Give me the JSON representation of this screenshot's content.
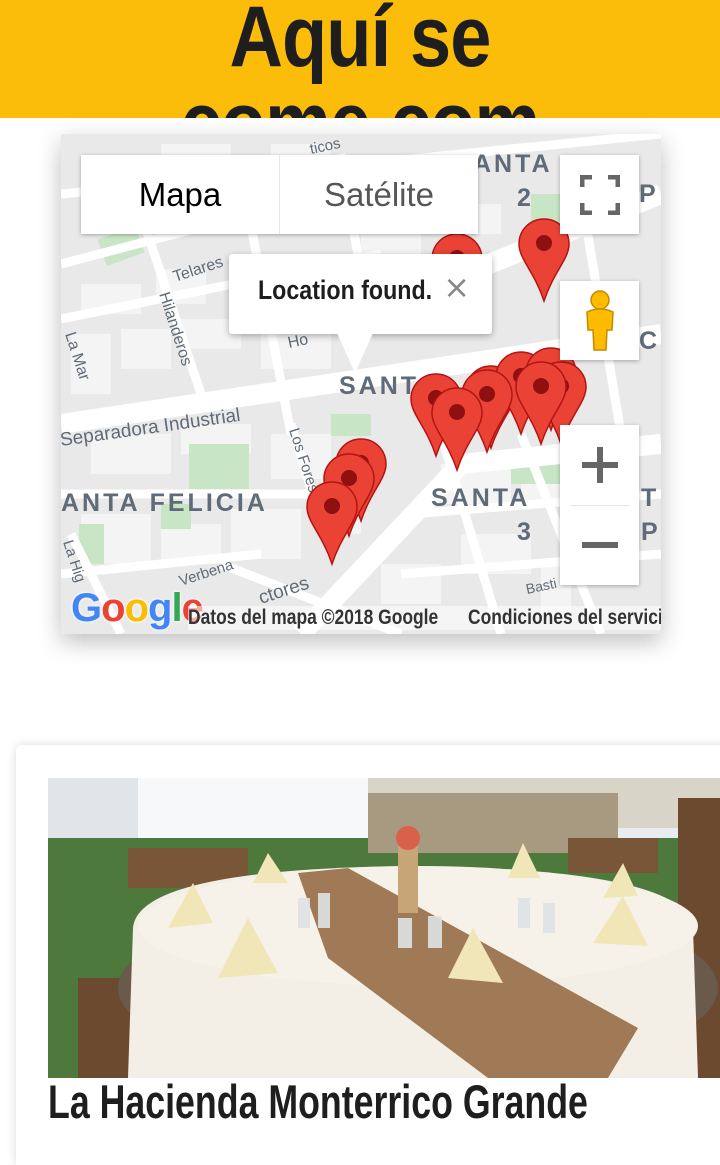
{
  "header": {
    "site_title": "Aquí se come.com",
    "bg_color": "#fbbd0a"
  },
  "map": {
    "map_type_options": [
      {
        "label": "Mapa",
        "active": true
      },
      {
        "label": "Satélite",
        "active": false
      }
    ],
    "info_window": {
      "text": "Location found.",
      "close_symbol": "×"
    },
    "street_labels": {
      "separadora": "Separadora Industrial",
      "santa_felicia": "ANTA FELICIA",
      "santa_top": "SANT",
      "santa_2": "ANTA",
      "santa_2_num": "2",
      "santa_3": "SANTA",
      "santa_3_num": "3",
      "telares": "Telares",
      "hilanderos": "Hilanderos",
      "la_mar": "La Mar",
      "los_fores": "Los Fores",
      "la_hig": "La Hig",
      "verbena": "Verbena",
      "ctores": "ctores",
      "ticos": "ticos",
      "basti": "Basti",
      "ho": "Ho",
      "cutoff_c": "C",
      "cutoff_p": "P",
      "cutoff_t": "T",
      "cutoff_p2": "P"
    },
    "logo_text": "Google",
    "logo_colors": [
      "#4285f4",
      "#ea4335",
      "#fbbc05",
      "#4285f4",
      "#34a853",
      "#ea4335"
    ],
    "attribution": "Datos del mapa ©2018 Google",
    "terms_link": "Condiciones del servicio",
    "controls": {
      "fullscreen_icon": "fullscreen-icon",
      "pegman_icon": "pegman-icon",
      "zoom_in": "+",
      "zoom_out": "−"
    },
    "marker_color": "#ea4335"
  },
  "listing": {
    "title": "La Hacienda Monterrico Grande"
  }
}
